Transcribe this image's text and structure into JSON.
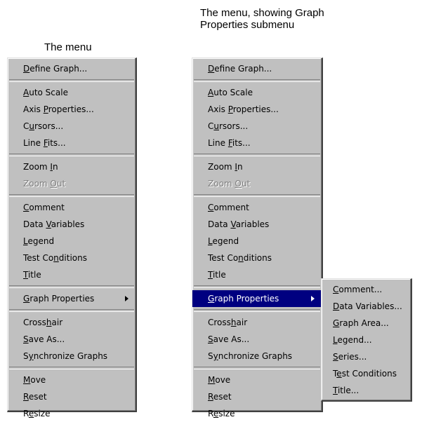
{
  "captions": {
    "left": "The menu",
    "right": "The menu, showing Graph Properties submenu"
  },
  "colors": {
    "menu_bg": "#c0c0c0",
    "highlight_bg": "#000080",
    "highlight_text": "#ffffff",
    "disabled_text": "#808080"
  },
  "menu": {
    "groups": [
      [
        {
          "label": "Define Graph...",
          "mnemonic_index": 0
        }
      ],
      [
        {
          "label": "Auto Scale",
          "mnemonic_index": 0
        },
        {
          "label": "Axis Properties...",
          "mnemonic_index": 5
        },
        {
          "label": "Cursors...",
          "mnemonic_index": 1
        },
        {
          "label": "Line Fits...",
          "mnemonic_index": 5
        }
      ],
      [
        {
          "label": "Zoom In",
          "mnemonic_index": 5
        },
        {
          "label": "Zoom Out",
          "mnemonic_index": 5,
          "disabled": true
        }
      ],
      [
        {
          "label": "Comment",
          "mnemonic_index": 0
        },
        {
          "label": "Data Variables",
          "mnemonic_index": 5
        },
        {
          "label": "Legend",
          "mnemonic_index": 0
        },
        {
          "label": "Test Conditions",
          "mnemonic_index": 7
        },
        {
          "label": "Title",
          "mnemonic_index": 0
        }
      ],
      [
        {
          "label": "Graph Properties",
          "mnemonic_index": 0,
          "submenu": true
        }
      ],
      [
        {
          "label": "Crosshair",
          "mnemonic_index": 5
        },
        {
          "label": "Save As...",
          "mnemonic_index": 0
        },
        {
          "label": "Synchronize Graphs",
          "mnemonic_index": 1
        }
      ],
      [
        {
          "label": "Move",
          "mnemonic_index": 0
        },
        {
          "label": "Reset",
          "mnemonic_index": 0
        },
        {
          "label": "Resize",
          "mnemonic_index": 1
        }
      ]
    ]
  },
  "submenu": {
    "items": [
      {
        "label": "Comment...",
        "mnemonic_index": 0
      },
      {
        "label": "Data Variables...",
        "mnemonic_index": 0
      },
      {
        "label": "Graph Area...",
        "mnemonic_index": 0
      },
      {
        "label": "Legend...",
        "mnemonic_index": 0
      },
      {
        "label": "Series...",
        "mnemonic_index": 0
      },
      {
        "label": "Test Conditions",
        "mnemonic_index": 1
      },
      {
        "label": "Title...",
        "mnemonic_index": 0
      }
    ]
  },
  "highlighted_item_right": "Graph Properties"
}
